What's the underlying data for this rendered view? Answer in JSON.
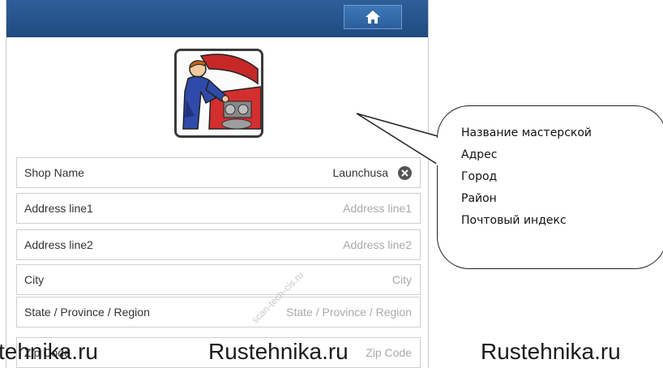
{
  "header": {
    "home_icon": "home-icon"
  },
  "profile": {
    "image": "mechanic-illustration"
  },
  "form": {
    "rows": [
      {
        "label": "Shop Name",
        "value": "Launchusa"
      },
      {
        "label": "Address line1",
        "placeholder": "Address line1"
      },
      {
        "label": "Address line2",
        "placeholder": "Address line2"
      },
      {
        "label": "City",
        "placeholder": "City"
      },
      {
        "label": "State / Province / Region",
        "placeholder": "State / Province / Region"
      },
      {
        "label": "Zip Code",
        "placeholder": "Zip Code"
      }
    ]
  },
  "callout": {
    "lines": [
      "Название мастерской",
      "Адрес",
      "Город",
      "Район",
      "Почтовый индекс"
    ]
  },
  "watermarks": {
    "left": "tehnika.ru",
    "center": "Rustehnika.ru",
    "right": "Rustehnika.ru",
    "diagonal": "scan-tech-cis.ru"
  },
  "colors": {
    "topbar": "#1f4a80",
    "home_button": "#2b5f9c"
  }
}
